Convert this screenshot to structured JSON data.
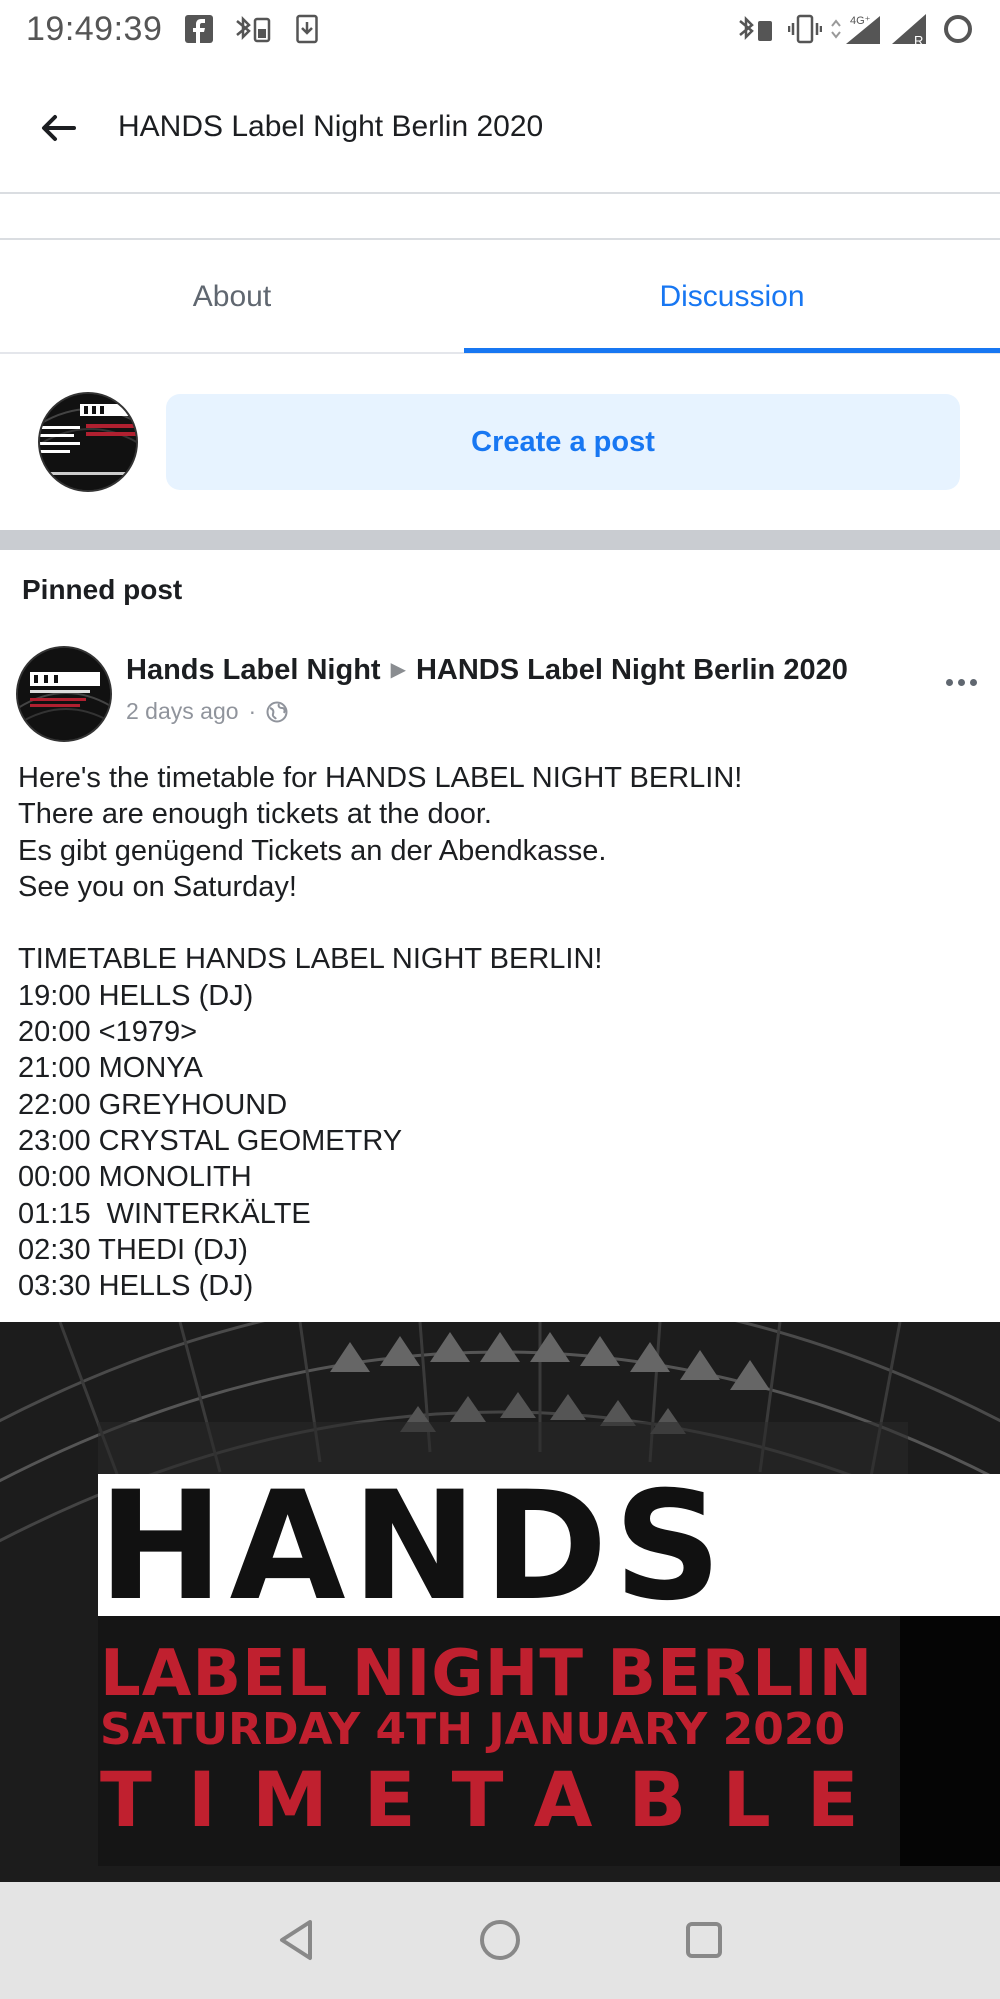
{
  "status_bar": {
    "time": "19:49:39",
    "icons_left": [
      "facebook-icon",
      "bluetooth-battery-icon",
      "download-icon"
    ],
    "icons_right": [
      "bluetooth-battery-icon",
      "vibrate-icon",
      "data-arrows-icon",
      "signal-icon",
      "signal-roaming-icon",
      "battery-ring-icon"
    ],
    "network_label": "4G⁺",
    "roaming_label": "R"
  },
  "header": {
    "title": "HANDS Label Night Berlin 2020",
    "back_icon": "arrow-left-icon"
  },
  "tabs": [
    {
      "label": "About",
      "active": false
    },
    {
      "label": "Discussion",
      "active": true
    }
  ],
  "composer": {
    "button_label": "Create a post"
  },
  "pinned": {
    "label": "Pinned post",
    "author": "Hands Label Night",
    "target": "HANDS Label Night Berlin 2020",
    "time": "2 days ago",
    "separator": "·",
    "privacy_icon": "globe-icon",
    "body": "Here's the timetable for HANDS LABEL NIGHT BERLIN!\nThere are enough tickets at the door.\nEs gibt genügend Tickets an der Abendkasse.\nSee you on Saturday!\n\nTIMETABLE HANDS LABEL NIGHT BERLIN!\n19:00 HELLS (DJ)\n20:00 <1979>\n21:00 MONYA\n22:00 GREYHOUND\n23:00 CRYSTAL GEOMETRY\n00:00 MONOLITH\n01:15  WINTERKÄLTE\n02:30 THEDI (DJ)\n03:30 HELLS (DJ)"
  },
  "poster": {
    "logo_text": "HANDS",
    "line1": "LABEL NIGHT BERLIN",
    "line2": "SATURDAY 4TH JANUARY 2020",
    "line3": "TIMETABLE"
  },
  "nav_bar": {
    "buttons": [
      "back-triangle-icon",
      "home-circle-icon",
      "recents-square-icon"
    ]
  },
  "colors": {
    "accent": "#1877f2",
    "composer_bg": "#e7f3ff",
    "poster_red": "#c0202f",
    "divider": "#c9ccd1"
  }
}
